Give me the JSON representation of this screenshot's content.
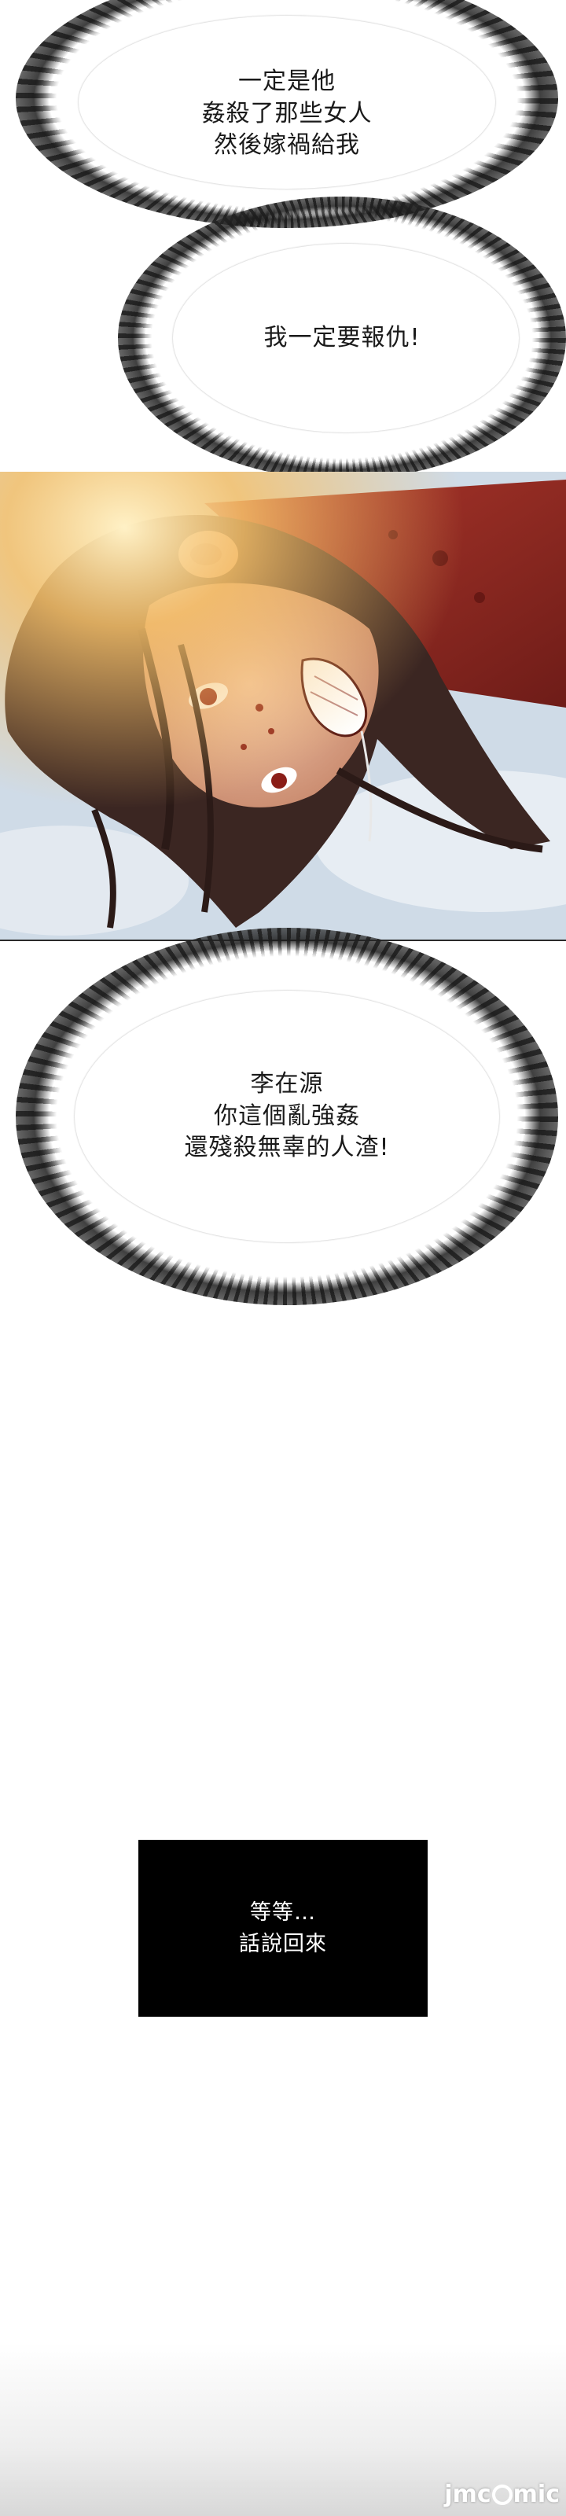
{
  "bubbles": [
    {
      "lines": [
        "一定是他",
        "姦殺了那些女人",
        "然後嫁禍給我"
      ]
    },
    {
      "lines": [
        "我一定要報仇!"
      ]
    },
    {
      "lines": [
        "李在源",
        "你這個亂強姦",
        "還殘殺無辜的人渣!"
      ]
    }
  ],
  "caption": {
    "lines": [
      "等等…",
      "話說回來"
    ]
  },
  "watermark": {
    "left": "jmc",
    "right": "mic"
  },
  "colors": {
    "caption_bg": "#000000",
    "caption_text": "#ffffff",
    "bubble_text": "#1a1a1a",
    "hair": "#3b2622",
    "skin": "#e8b49a",
    "blood": "#9a2a22",
    "sunlight": "#f6c16a"
  }
}
